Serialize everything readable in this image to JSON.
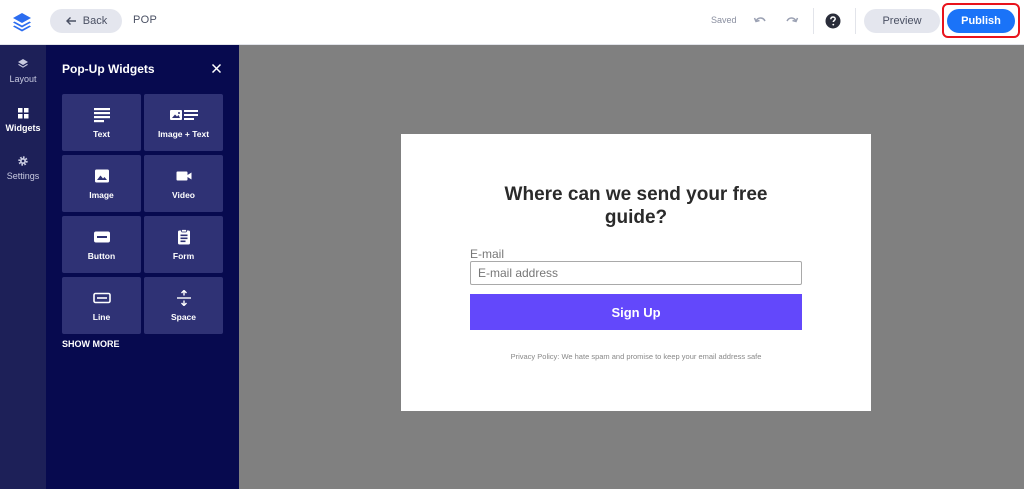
{
  "topbar": {
    "back_label": "Back",
    "doc_title": "POP",
    "save_status": "Saved",
    "preview_label": "Preview",
    "publish_label": "Publish"
  },
  "rail": {
    "items": [
      {
        "label": "Layout",
        "icon": "layers-icon"
      },
      {
        "label": "Widgets",
        "icon": "widgets-icon"
      },
      {
        "label": "Settings",
        "icon": "gear-icon"
      }
    ]
  },
  "panel": {
    "title": "Pop-Up Widgets",
    "widgets": [
      {
        "label": "Text",
        "icon": "text-lines-icon"
      },
      {
        "label": "Image + Text",
        "icon": "image-text-icon"
      },
      {
        "label": "Image",
        "icon": "image-icon"
      },
      {
        "label": "Video",
        "icon": "video-camera-icon"
      },
      {
        "label": "Button",
        "icon": "button-icon"
      },
      {
        "label": "Form",
        "icon": "clipboard-form-icon"
      },
      {
        "label": "Line",
        "icon": "line-icon"
      },
      {
        "label": "Space",
        "icon": "space-icon"
      }
    ],
    "show_more": "SHOW MORE"
  },
  "popup": {
    "heading": "Where can we send your free guide?",
    "email_label": "E-mail",
    "email_placeholder": "E-mail address",
    "button_label": "Sign Up",
    "privacy": "Privacy Policy: We hate spam and promise to keep your email address safe"
  },
  "colors": {
    "publish": "#1a73f8",
    "highlight": "#e8131c",
    "rail": "#1d2058",
    "panel": "#070a4f",
    "tile": "#2f3275",
    "signup": "#6348fb",
    "canvas": "#808080"
  }
}
